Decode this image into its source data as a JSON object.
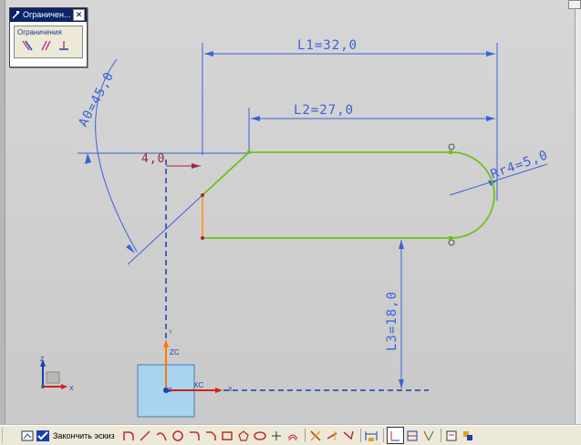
{
  "panel": {
    "title": "Ограничен...",
    "close_glyph": "✕",
    "group_label": "Ограничения"
  },
  "dimensions": {
    "l1": "L1=32,0",
    "l2": "L2=27,0",
    "l3": "L3=18,0",
    "a0": "A0=45,0",
    "rr4": "Rr4=5,0",
    "chamfer": "4,0"
  },
  "axes": {
    "zc": "ZC",
    "xc": "XC",
    "x": "X",
    "y": "Y",
    "z": "Z",
    "origin_x": "X",
    "origin_z": "Z"
  },
  "toolbar": {
    "finish_sketch": "Закончить эскиз",
    "icons": [
      "sketch-icon",
      "finish-sketch-icon",
      "profile-icon",
      "line-icon",
      "arc-icon",
      "circle-icon",
      "fillet-icon",
      "chamfer-icon",
      "rectangle-icon",
      "polygon-icon",
      "ellipse-icon",
      "point-icon",
      "offset-icon",
      "trim-icon",
      "extend-icon",
      "corner-icon",
      "dimension-icon",
      "constraint-icon",
      "autoconstraint-icon",
      "fix-icon",
      "display-icon",
      "sketch-settings-icon"
    ]
  },
  "colors": {
    "dimension": "#3a62d8",
    "sketch": "#6cc21c",
    "constraint": "#a0283c",
    "accent_orange": "#ff7a00",
    "csys_box": "#a8d4f0"
  }
}
